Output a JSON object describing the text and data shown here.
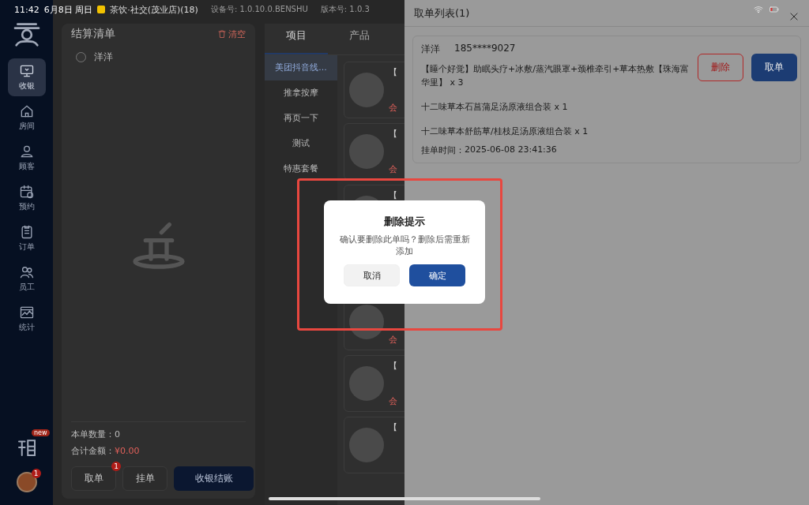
{
  "status_bar": {
    "time": "11:42",
    "date": "6月8日 周日",
    "store": "茶饮·社交(茂业店)(18)",
    "device": "设备号: 1.0.10.0.BENSHU",
    "version": "版本号:  1.0.3"
  },
  "sidebar": {
    "items": [
      {
        "label": "收银",
        "selected": true
      },
      {
        "label": "房间",
        "selected": false
      },
      {
        "label": "顾客",
        "selected": false
      },
      {
        "label": "预约",
        "selected": false
      },
      {
        "label": "订单",
        "selected": false
      },
      {
        "label": "员工",
        "selected": false
      },
      {
        "label": "统计",
        "selected": false
      }
    ],
    "new_badge": "new",
    "avatar_badge": "1"
  },
  "settlement": {
    "title": "结算清单",
    "clear_label": "清空",
    "customers": [
      {
        "name": "洋洋",
        "selected": false
      }
    ],
    "quantity_label": "本单数量：",
    "quantity": "0",
    "total_label": "合计金额：",
    "total": "¥0.00",
    "buttons": [
      {
        "label": "取单",
        "kind": "secondary",
        "badge": "1"
      },
      {
        "label": "挂单",
        "kind": "secondary"
      },
      {
        "label": "收银结账",
        "kind": "primary"
      }
    ]
  },
  "catalog": {
    "tabs": [
      {
        "label": "项目",
        "selected": true
      },
      {
        "label": "产品",
        "selected": false
      }
    ],
    "categories": [
      {
        "label": "美团抖音线...",
        "selected": true
      },
      {
        "label": "推拿按摩",
        "selected": false
      },
      {
        "label": "再页一下",
        "selected": false
      },
      {
        "label": "测试",
        "selected": false
      },
      {
        "label": "特惠套餐",
        "selected": false
      }
    ],
    "products": [
      {
        "title": "【",
        "price": "会"
      },
      {
        "title": "【",
        "price": "会"
      },
      {
        "title": "【"
      },
      {
        "price": "会"
      },
      {
        "title": "【",
        "price": "会"
      },
      {
        "title": "【"
      }
    ]
  },
  "drawer": {
    "title": "取单列表(1)",
    "orders": [
      {
        "name": "洋洋",
        "phone": "185****9027",
        "items": [
          "【睡个好觉】助眠头疗+冰敷/蒸汽眼罩+颈椎牵引+草本热敷【珠海富华里】 x 3",
          "十二味草本石菖蒲足汤原液组合装 x 1",
          "十二味草本舒筋草/桂枝足汤原液组合装 x 1"
        ],
        "time_label": "挂单时间：",
        "time": "2025-06-08 23:41:36",
        "buttons": [
          {
            "label": "删除",
            "kind": "danger"
          },
          {
            "label": "取单",
            "kind": "primary"
          }
        ]
      }
    ]
  },
  "dialog": {
    "title": "删除提示",
    "message": "确认要删除此单吗？删除后需重新添加",
    "buttons": [
      {
        "label": "取消",
        "kind": "secondary"
      },
      {
        "label": "确定",
        "kind": "primary"
      }
    ]
  }
}
